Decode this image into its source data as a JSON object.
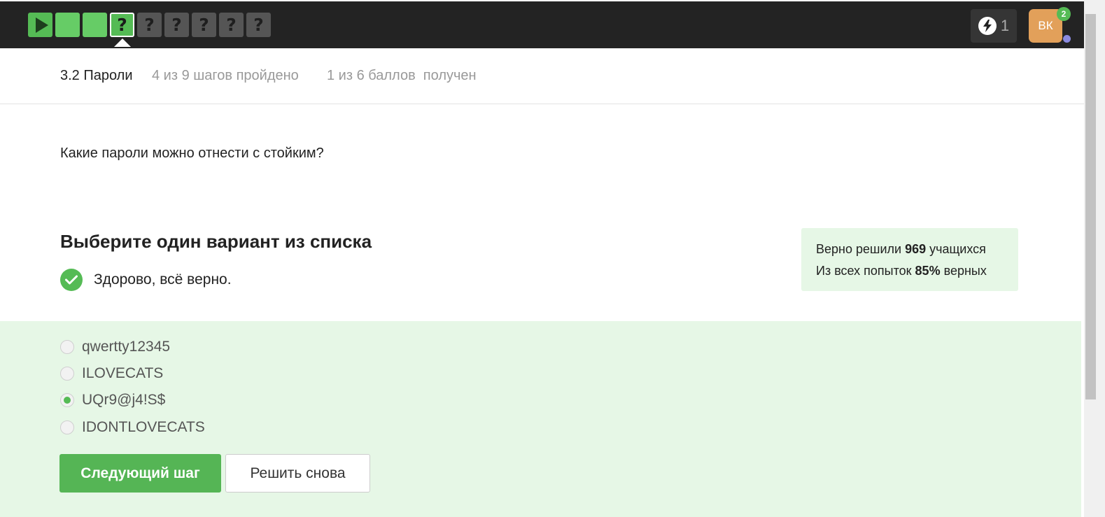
{
  "steps": [
    {
      "state": "done",
      "icon": "play-icon"
    },
    {
      "state": "done",
      "icon": ""
    },
    {
      "state": "done",
      "icon": ""
    },
    {
      "state": "current",
      "icon": "question-icon",
      "label": "?"
    },
    {
      "state": "pending",
      "icon": "question-icon",
      "label": "?"
    },
    {
      "state": "pending",
      "icon": "question-icon",
      "label": "?"
    },
    {
      "state": "pending",
      "icon": "question-icon",
      "label": "?"
    },
    {
      "state": "pending",
      "icon": "question-icon",
      "label": "?"
    },
    {
      "state": "pending",
      "icon": "question-icon",
      "label": "?"
    }
  ],
  "header": {
    "energy_count": "1",
    "avatar_initials": "ВК",
    "notification_count": "2"
  },
  "lesson": {
    "title": "3.2 Пароли",
    "steps_progress": "4 из 9 шагов пройдено",
    "score_progress": "1 из 6 баллов  получен"
  },
  "question": "Какие пароли можно отнести с стойким?",
  "quiz": {
    "section_title": "Выберите один вариант из списка",
    "feedback": "Здорово, всё верно.",
    "options": [
      {
        "label": "qwertty12345",
        "selected": false
      },
      {
        "label": "ILOVECATS",
        "selected": false
      },
      {
        "label": "UQr9@j4!S$",
        "selected": true
      },
      {
        "label": "IDONTLOVECATS",
        "selected": false
      }
    ],
    "next_label": "Следующий шаг",
    "retry_label": "Решить снова"
  },
  "stats": {
    "solved_prefix": "Верно решили ",
    "solved_count": "969",
    "solved_suffix": " учащихся",
    "attempts_prefix": "Из всех попыток ",
    "attempts_percent": "85%",
    "attempts_suffix": " верных"
  },
  "colors": {
    "accent": "#55bb55",
    "topbar": "#232323",
    "answers_bg": "#e6f7e6",
    "avatar": "#e2a05a"
  }
}
